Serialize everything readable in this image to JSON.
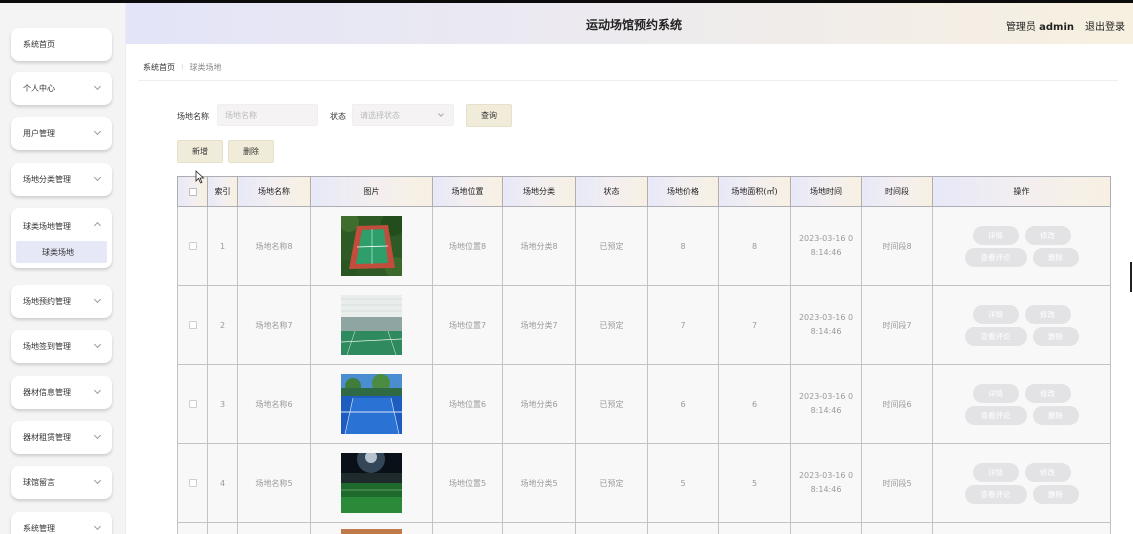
{
  "header": {
    "title": "运动场馆预约系统",
    "user_role": "管理员",
    "user_name": "admin",
    "logout": "退出登录"
  },
  "sidebar": {
    "items": [
      {
        "label": "系统首页",
        "has_arrow": false
      },
      {
        "label": "个人中心",
        "has_arrow": true
      },
      {
        "label": "用户管理",
        "has_arrow": true
      },
      {
        "label": "场地分类管理",
        "has_arrow": true
      },
      {
        "label": "球类场地管理",
        "has_arrow": true,
        "expanded": true,
        "sub": "球类场地"
      },
      {
        "label": "场地预约管理",
        "has_arrow": true
      },
      {
        "label": "场地签到管理",
        "has_arrow": true
      },
      {
        "label": "器材信息管理",
        "has_arrow": true
      },
      {
        "label": "器材租赁管理",
        "has_arrow": true
      },
      {
        "label": "球馆留言",
        "has_arrow": true
      },
      {
        "label": "系统管理",
        "has_arrow": true
      }
    ]
  },
  "breadcrumb": {
    "home": "系统首页",
    "current": "球类场地"
  },
  "search": {
    "name_label": "场地名称",
    "name_placeholder": "场地名称",
    "status_label": "状态",
    "status_placeholder": "请选择状态",
    "query_button": "查询"
  },
  "actions": {
    "add": "新增",
    "delete": "删除"
  },
  "table": {
    "headers": [
      "索引",
      "场地名称",
      "图片",
      "场地位置",
      "场地分类",
      "状态",
      "场地价格",
      "场地面积(㎡)",
      "场地时间",
      "时间段",
      "操作"
    ],
    "op_labels": {
      "detail": "详情",
      "edit": "修改",
      "reviews": "查看评论",
      "delete": "删除"
    },
    "rows": [
      {
        "index": "1",
        "name": "场地名称8",
        "location": "场地位置8",
        "category": "场地分类8",
        "status": "已预定",
        "price": "8",
        "area": "8",
        "time_line1": "2023-03-16 0",
        "time_line2": "8:14:46",
        "period": "时间段8",
        "image": "outdoor-red-green-court"
      },
      {
        "index": "2",
        "name": "场地名称7",
        "location": "场地位置7",
        "category": "场地分类7",
        "status": "已预定",
        "price": "7",
        "area": "7",
        "time_line1": "2023-03-16 0",
        "time_line2": "8:14:46",
        "period": "时间段7",
        "image": "indoor-green-court"
      },
      {
        "index": "3",
        "name": "场地名称6",
        "location": "场地位置6",
        "category": "场地分类6",
        "status": "已预定",
        "price": "6",
        "area": "6",
        "time_line1": "2023-03-16 0",
        "time_line2": "8:14:46",
        "period": "时间段6",
        "image": "blue-tennis-court"
      },
      {
        "index": "4",
        "name": "场地名称5",
        "location": "场地位置5",
        "category": "场地分类5",
        "status": "已预定",
        "price": "5",
        "area": "5",
        "time_line1": "2023-03-16 0",
        "time_line2": "8:14:46",
        "period": "时间段5",
        "image": "night-football-stadium"
      }
    ]
  },
  "colors": {
    "header_left": "#e3e4f8",
    "header_right": "#f7f0e0",
    "button_bg": "#f1ecda",
    "submenu_active": "#e6e8f7",
    "op_button": "#e3e3e5"
  }
}
